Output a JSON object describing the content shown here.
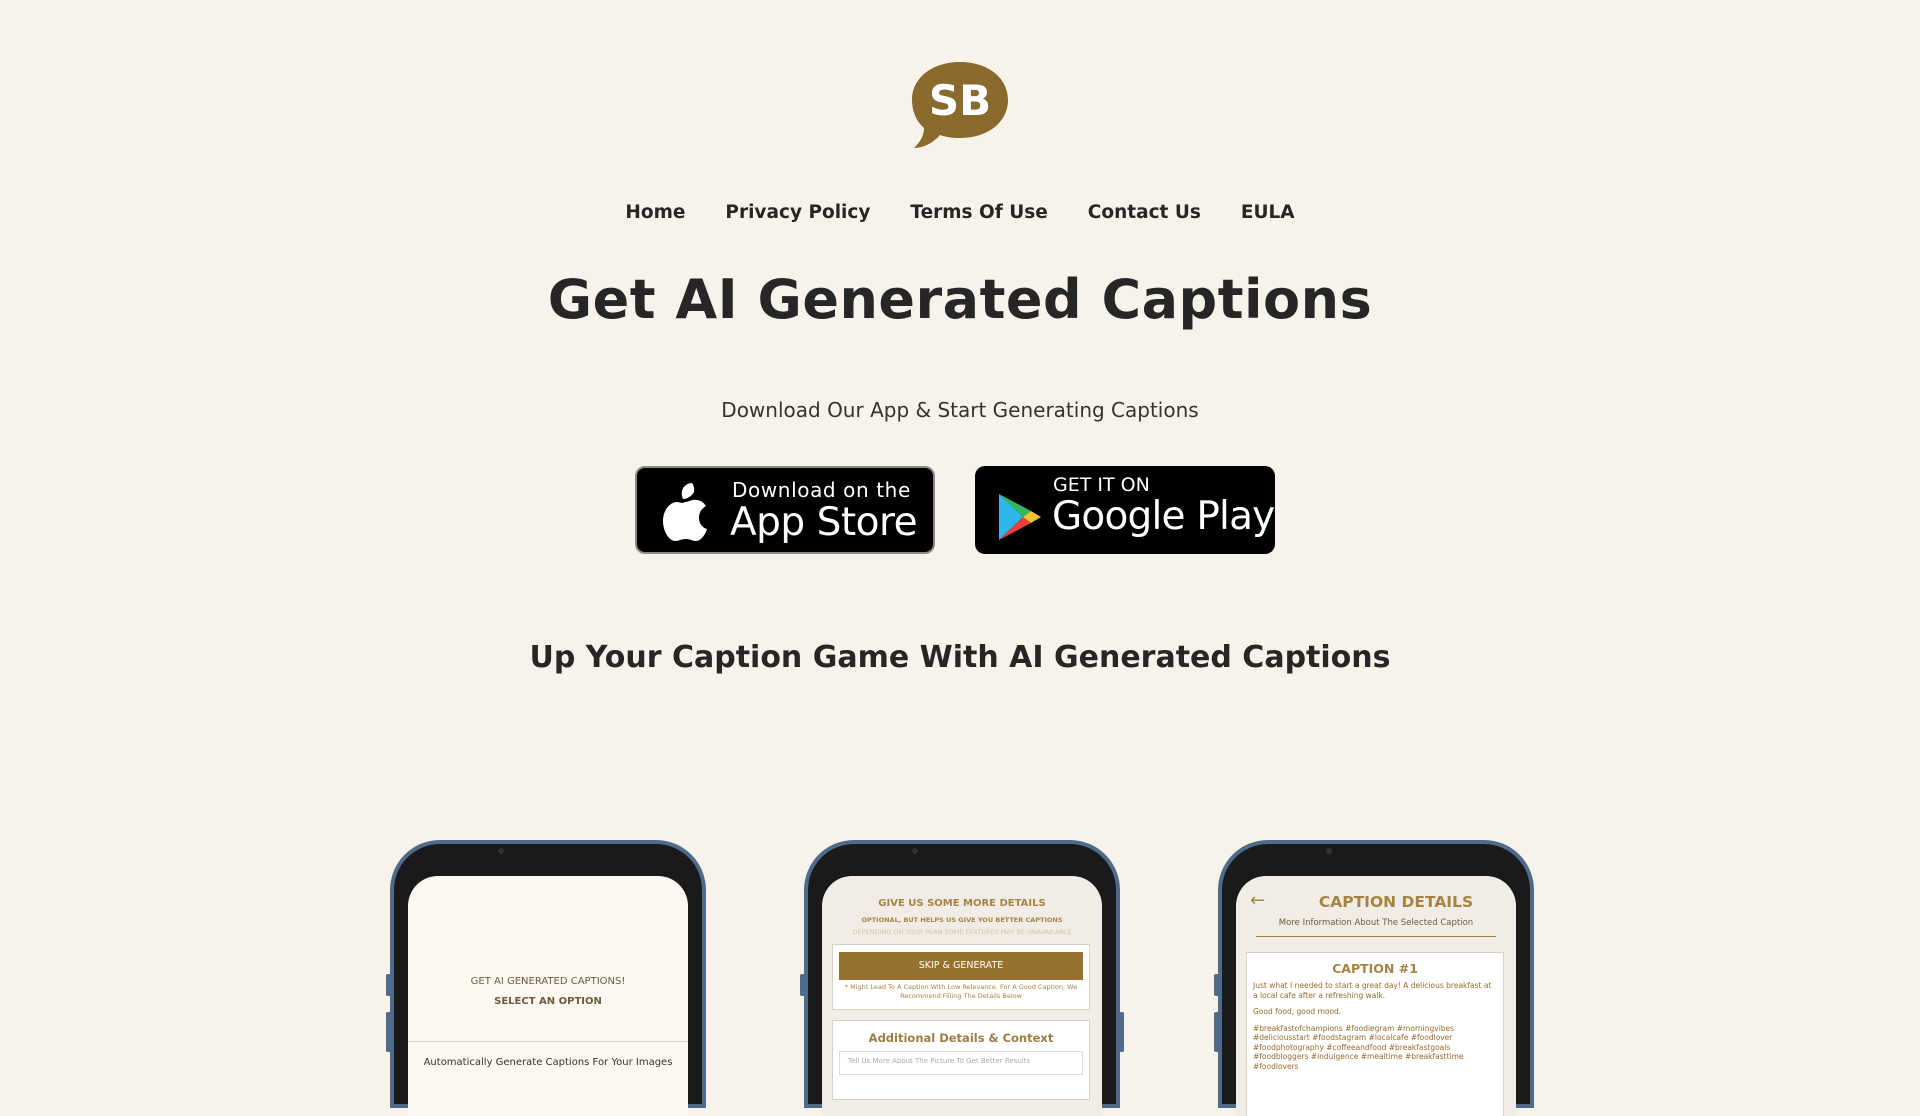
{
  "logo": {
    "text": "SB",
    "color": "#8a6a2c"
  },
  "nav": [
    "Home",
    "Privacy Policy",
    "Terms Of Use",
    "Contact Us",
    "EULA"
  ],
  "hero": {
    "title": "Get AI Generated Captions",
    "subtitle": "Download Our App & Start Generating Captions"
  },
  "stores": {
    "appstore": {
      "small": "Download on the",
      "big": "App Store",
      "icon": "apple-icon"
    },
    "googleplay": {
      "small": "GET IT ON",
      "big": "Google Play",
      "icon": "play-icon"
    }
  },
  "section_title": "Up Your Caption Game With AI Generated Captions",
  "phones": [
    {
      "line1": "GET AI GENERATED CAPTIONS!",
      "line2": "SELECT AN OPTION",
      "line3": "Automatically Generate Captions For Your Images"
    },
    {
      "heading": "GIVE US SOME MORE DETAILS",
      "sub": "OPTIONAL, BUT HELPS US GIVE YOU BETTER CAPTIONS",
      "sub2": "DEPENDING ON YOUR PLAN SOME FEATURES MAY BE UNAVAILABLE",
      "button": "SKIP & GENERATE",
      "note": "* Might Lead To A Caption With Low Relevance. For A Good Caption, We Recommend Filling The Details Below",
      "section": "Additional Details & Context",
      "placeholder": "Tell Us More About The Picture To Get Better Results"
    },
    {
      "heading": "CAPTION DETAILS",
      "sub": "More Information About The Selected Caption",
      "card_title": "CAPTION #1",
      "caption": "Just what I needed to start a great day! A delicious breakfast at a local cafe after a refreshing walk.",
      "mood": "Good food, good mood.",
      "hashtags": "#breakfastofchampions #foodiegram #morningvibes #deliciousstart #foodstagram #localcafe #foodlover #foodphotography #coffeeandfood #breakfastgoals #foodbloggers #indulgence #mealtime #breakfasttime #foodlovers"
    }
  ]
}
